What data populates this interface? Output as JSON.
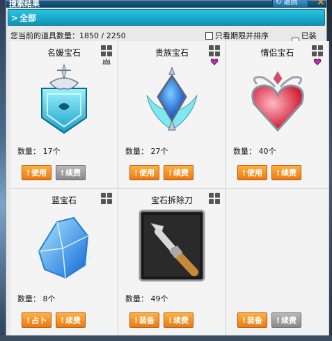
{
  "window": {
    "title": "搜索结果",
    "back_label": "返回",
    "close_label": "×"
  },
  "tab": {
    "label": "全部"
  },
  "info": {
    "count_label": "您当前的道具数量：",
    "count_value": "1850  /  2250",
    "option_expire": "只看期限并排序",
    "option_equipped": "已装备"
  },
  "items": [
    {
      "name": "名媛宝石",
      "qty": "数量： 17个",
      "badge": "crown-badge",
      "buttons": [
        {
          "label": "使用",
          "style": "orange"
        },
        {
          "label": "续费",
          "style": "gray"
        }
      ]
    },
    {
      "name": "贵族宝石",
      "qty": "数量： 27个",
      "badge": "heart-badge",
      "buttons": [
        {
          "label": "使用",
          "style": "orange"
        },
        {
          "label": "续费",
          "style": "orange"
        }
      ]
    },
    {
      "name": "情侣宝石",
      "qty": "数量： 40个",
      "badge": "heart-badge",
      "buttons": [
        {
          "label": "使用",
          "style": "orange"
        },
        {
          "label": "续费",
          "style": "orange"
        }
      ]
    },
    {
      "name": "蓝宝石",
      "qty": "数量： 8个",
      "badge": "",
      "buttons": [
        {
          "label": "占卜",
          "style": "orange"
        },
        {
          "label": "续费",
          "style": "orange"
        }
      ]
    },
    {
      "name": "宝石拆除刀",
      "qty": "数量： 49个",
      "badge": "",
      "buttons": [
        {
          "label": "装备",
          "style": "orange"
        },
        {
          "label": "续费",
          "style": "orange"
        }
      ]
    },
    {
      "name": "",
      "qty": "",
      "badge": "",
      "buttons": [
        {
          "label": "装备",
          "style": "orange"
        },
        {
          "label": "续费",
          "style": "gray"
        }
      ]
    }
  ],
  "colors": {
    "tab_bg": "#0e93b5",
    "btn_orange": "#ec7a12",
    "btn_gray": "#8a8a8a"
  }
}
